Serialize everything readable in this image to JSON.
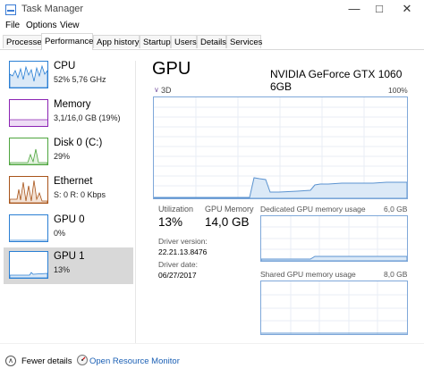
{
  "window": {
    "title": "Task Manager",
    "minimize_glyph": "—",
    "maximize_glyph": "□",
    "close_glyph": "✕"
  },
  "menu": [
    "File",
    "Options",
    "View"
  ],
  "tabs": [
    "Processes",
    "Performance",
    "App history",
    "Startup",
    "Users",
    "Details",
    "Services"
  ],
  "active_tab": "Performance",
  "sidebar": {
    "items": [
      {
        "title": "CPU",
        "sub": "52%  5,76 GHz",
        "color": "#2a7fd4"
      },
      {
        "title": "Memory",
        "sub": "3,1/16,0 GB (19%)",
        "color": "#8b22b3"
      },
      {
        "title": "Disk 0 (C:)",
        "sub": "29%",
        "color": "#4ea53e"
      },
      {
        "title": "Ethernet",
        "sub": "S: 0  R: 0 Kbps",
        "color": "#a8541a"
      },
      {
        "title": "GPU 0",
        "sub": "0%",
        "color": "#2a7fd4"
      },
      {
        "title": "GPU 1",
        "sub": "13%",
        "color": "#2a7fd4"
      }
    ],
    "selected": "GPU 1"
  },
  "detail": {
    "title": "GPU",
    "model": "NVIDIA GeForce GTX 1060 6GB",
    "engine_label": "3D",
    "engine_max": "100%",
    "utilization_label": "Utilization",
    "utilization_value": "13%",
    "gpu_memory_label": "GPU Memory",
    "gpu_memory_value": "14,0 GB",
    "driver_version_label": "Driver version:",
    "driver_version_value": "22.21.13.8476",
    "driver_date_label": "Driver date:",
    "driver_date_value": "06/27/2017",
    "dedicated_label": "Dedicated GPU memory usage",
    "dedicated_max": "6,0 GB",
    "shared_label": "Shared GPU memory usage",
    "shared_max": "8,0 GB"
  },
  "footer": {
    "fewer_details": "Fewer details",
    "open_resource_monitor": "Open Resource Monitor"
  },
  "colors": {
    "graph_border": "#7fa8d9",
    "graph_line": "#5b93d0",
    "graph_fill": "#dbe9f7",
    "selected_bg": "#d8d8d8"
  }
}
